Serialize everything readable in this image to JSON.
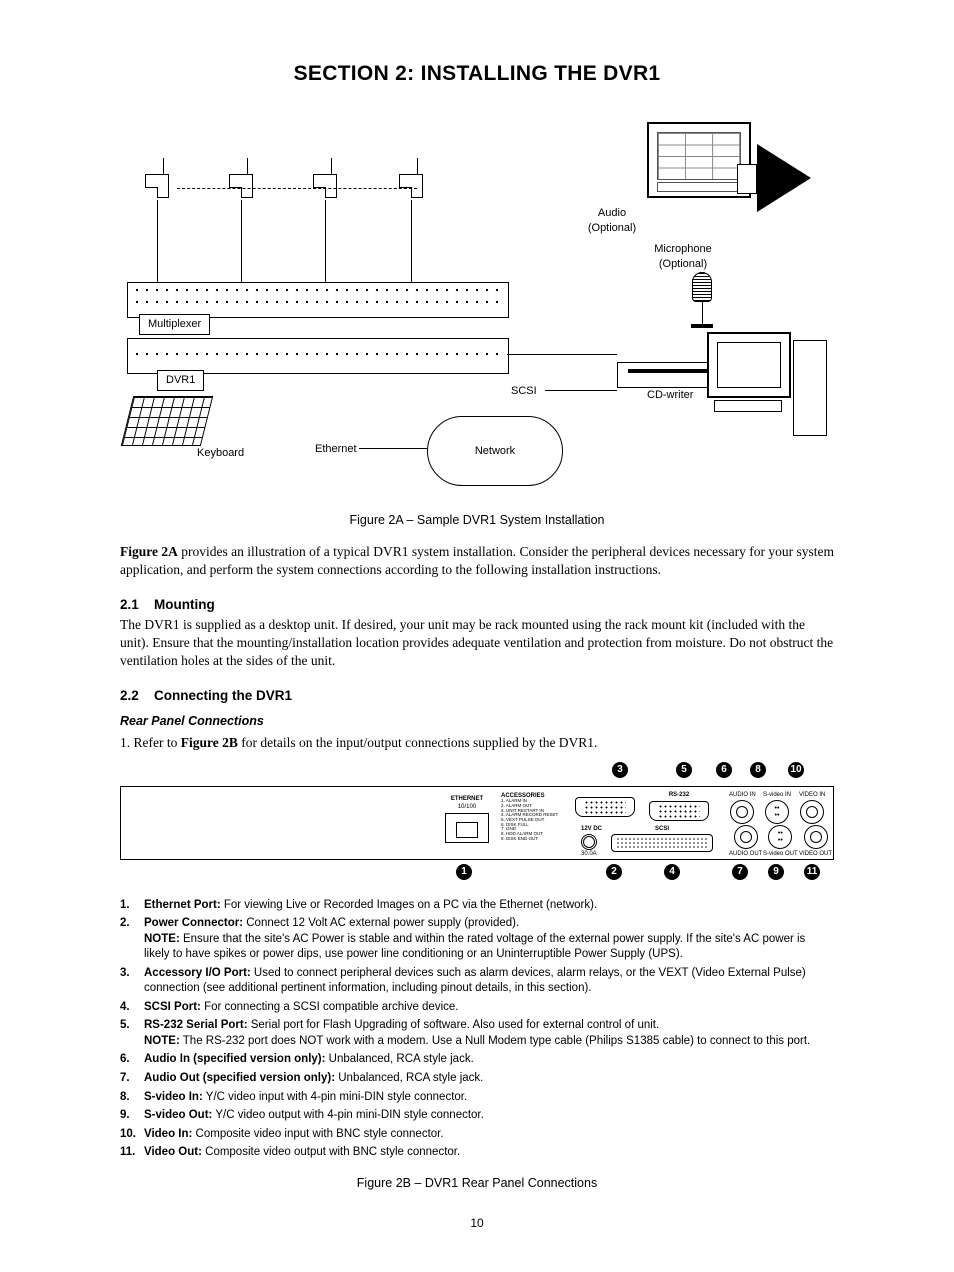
{
  "section_title": "SECTION 2:  INSTALLING THE DVR1",
  "fig2a": {
    "caption": "Figure 2A – Sample DVR1 System Installation",
    "labels": {
      "audio_optional": "Audio\n(Optional)",
      "microphone_optional": "Microphone\n(Optional)",
      "multiplexer": "Multiplexer",
      "dvr1": "DVR1",
      "keyboard": "Keyboard",
      "ethernet": "Ethernet",
      "network": "Network",
      "scsi": "SCSI",
      "cd_writer": "CD-writer"
    }
  },
  "intro_paragraph_lead": "Figure 2A",
  "intro_paragraph_rest": " provides an illustration of a typical DVR1 system installation. Consider the peripheral devices necessary for your system application, and perform the system connections according to the following installation instructions.",
  "s21": {
    "heading_num": "2.1",
    "heading_txt": "Mounting",
    "body": "The DVR1 is supplied as a desktop unit. If desired, your unit may be rack mounted using the rack mount kit (included with the unit). Ensure that the mounting/installation location provides adequate ventilation and protection from moisture. Do not obstruct the ventilation holes at the sides of the unit."
  },
  "s22": {
    "heading_num": "2.2",
    "heading_txt": "Connecting the DVR1",
    "subhead": "Rear Panel Connections",
    "step1_prefix": "1.  Refer to ",
    "step1_bold": "Figure 2B",
    "step1_suffix": " for details on the input/output connections supplied by the DVR1."
  },
  "fig2b": {
    "callouts_top": [
      "3",
      "5",
      "6",
      "8",
      "10"
    ],
    "callouts_bot": [
      "1",
      "2",
      "4",
      "7",
      "9",
      "11"
    ],
    "panel_labels": {
      "ethernet": "ETHERNET",
      "ethernet_sub": "10/100",
      "accessories": "ACCESSORIES",
      "acc_pins": "1. ALARM IN\n2. ALARM OUT\n3. UNIT RESTART IN\n4. ALARM RECORD RESET\n5. VEXT PULSE OUT\n6. DISK FULL\n7. GND\n8. HDD ALARM OUT\n9. DISK END OUT",
      "rs232": "RS-232",
      "power": "12V DC",
      "power_sub": "30.0A",
      "scsi": "SCSI",
      "audio_in": "AUDIO IN",
      "audio_out": "AUDIO OUT",
      "svideo_in": "S-video IN",
      "svideo_out": "S-video OUT",
      "video_in": "VIDEO IN",
      "video_out": "VIDEO OUT"
    },
    "caption": "Figure 2B – DVR1 Rear Panel Connections",
    "definitions": [
      {
        "n": "1.",
        "title": "Ethernet Port:",
        "text": " For viewing Live or Recorded Images on a PC via the Ethernet (network)."
      },
      {
        "n": "2.",
        "title": "Power Connector:",
        "text": " Connect 12 Volt AC external power supply (provided).",
        "note": "NOTE:  Ensure that the site's AC Power is stable and within the rated voltage of the external power supply. If the site's AC power is likely to have spikes or power dips, use power line conditioning or an Uninterruptible Power Supply (UPS)."
      },
      {
        "n": "3.",
        "title": "Accessory I/O Port:",
        "text": " Used to connect peripheral devices such as alarm devices, alarm relays, or the VEXT (Video External Pulse) connection (see additional pertinent information, including pinout details, in this section)."
      },
      {
        "n": "4.",
        "title": "SCSI Port:",
        "text": " For connecting a SCSI compatible archive device."
      },
      {
        "n": "5.",
        "title": "RS-232 Serial Port:",
        "text": " Serial port for Flash Upgrading of software.  Also used for external control of unit.",
        "note": "NOTE:  The RS-232 port does NOT work with a modem. Use a Null Modem type cable (Philips S1385 cable) to connect to this port."
      },
      {
        "n": "6.",
        "title": "Audio In (specified version only):",
        "text": " Unbalanced, RCA style jack."
      },
      {
        "n": "7.",
        "title": "Audio Out (specified version only):",
        "text": " Unbalanced, RCA style jack."
      },
      {
        "n": "8.",
        "title": "S-video In:",
        "text": " Y/C video input with 4-pin mini-DIN style connector."
      },
      {
        "n": "9.",
        "title": "S-video Out:",
        "text": " Y/C video output with 4-pin mini-DIN style connector."
      },
      {
        "n": "10.",
        "title": "Video In:",
        "text": " Composite video input with BNC style connector."
      },
      {
        "n": "11.",
        "title": "Video Out:",
        "text": " Composite video output with BNC style connector."
      }
    ]
  },
  "page_number": "10"
}
